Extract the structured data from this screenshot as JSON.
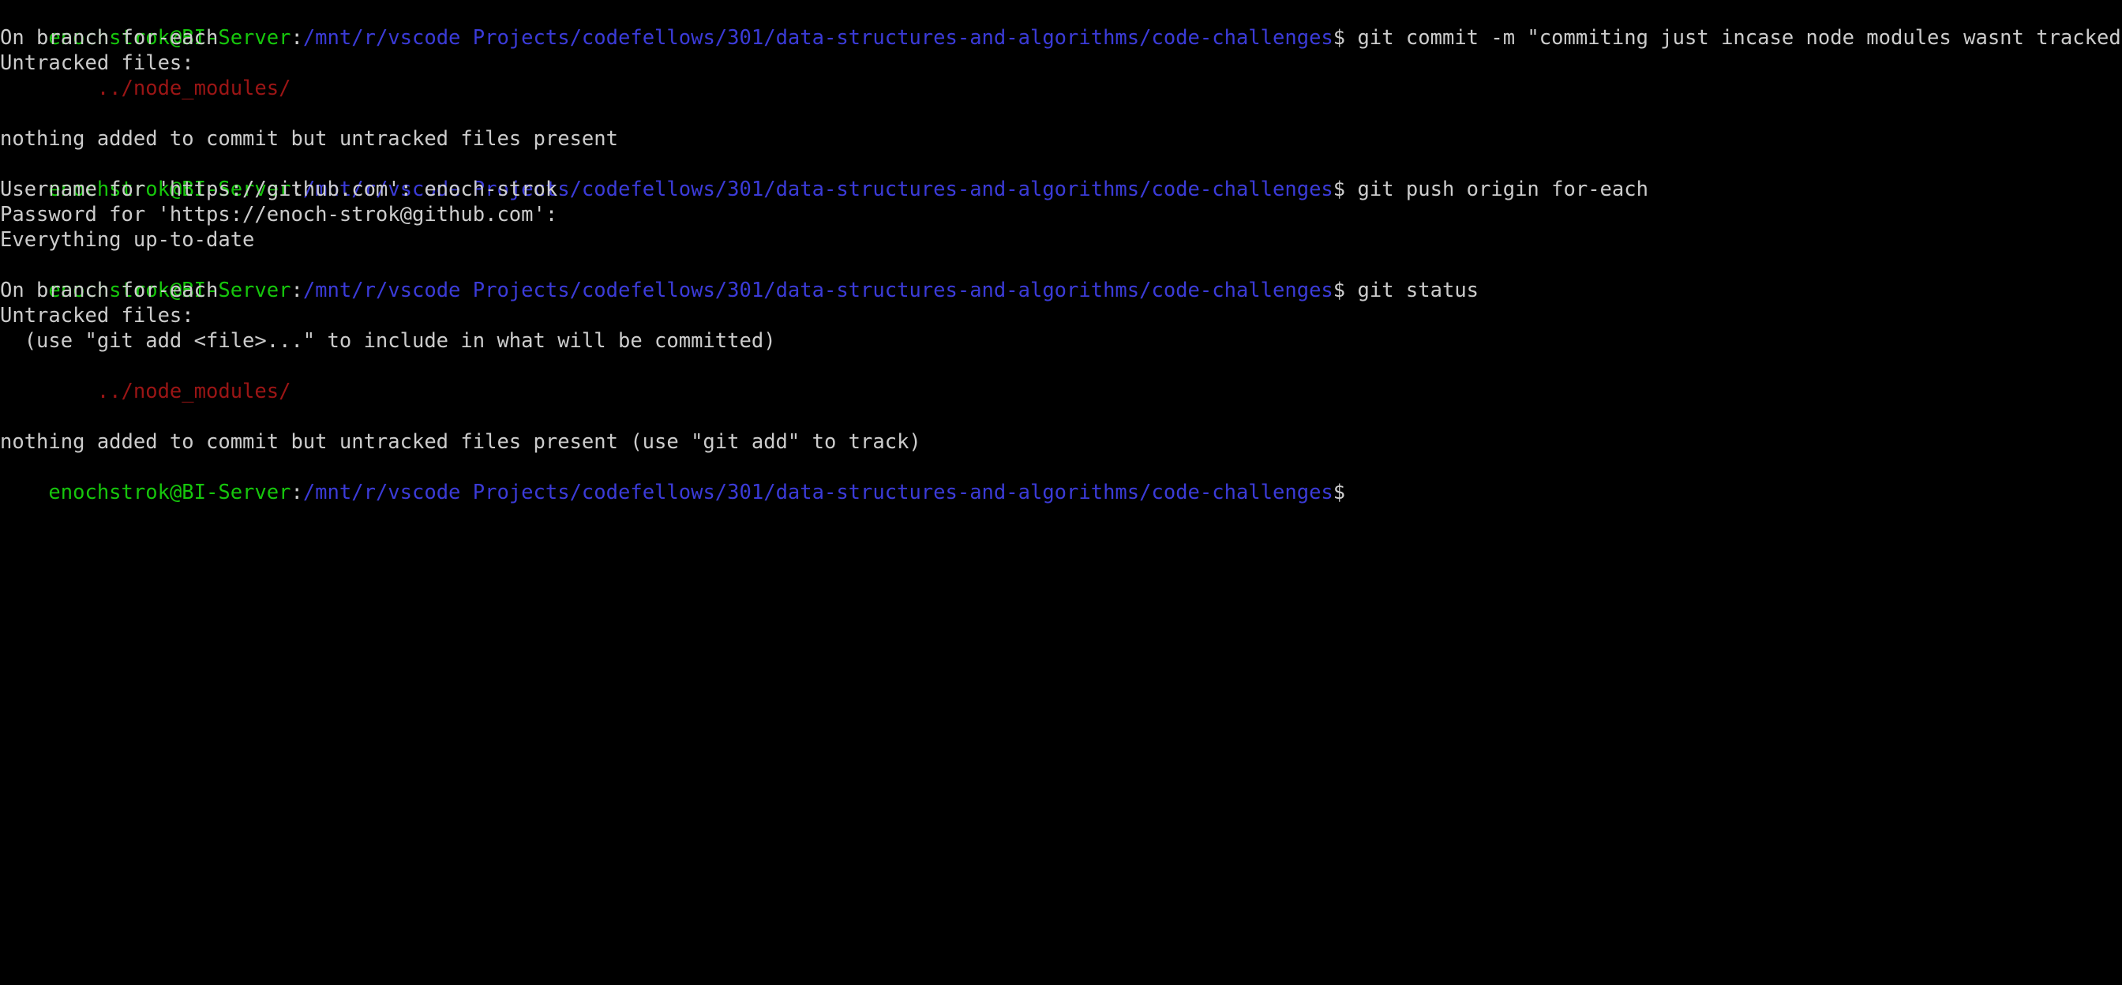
{
  "terminal": {
    "colors": {
      "background": "#000000",
      "text": "#cccccc",
      "user_host": "#16c60c",
      "path": "#3b3bd8",
      "untracked": "#9b1515"
    },
    "prompt": {
      "user_host": "enochstrok@BI-Server",
      "colon": ":",
      "path": "/mnt/r/vscode Projects/codefellows/301/data-structures-and-algorithms/code-challenges",
      "symbol": "$ "
    },
    "commands": {
      "commit": "git commit -m \"commiting just incase node modules wasnt tracked\"",
      "push": "git push origin for-each",
      "status": "git status"
    },
    "output": {
      "on_branch_1": "On branch for-each",
      "untracked_files_1": "Untracked files:",
      "node_modules_1": "        ../node_modules/",
      "nothing_added_1": "nothing added to commit but untracked files present",
      "username": "Username for 'https://github.com': enoch-strok",
      "password": "Password for 'https://enoch-strok@github.com':",
      "up_to_date": "Everything up-to-date",
      "on_branch_2": "On branch for-each",
      "untracked_files_2": "Untracked files:",
      "use_git_add": "  (use \"git add <file>...\" to include in what will be committed)",
      "node_modules_2": "        ../node_modules/",
      "nothing_added_2": "nothing added to commit but untracked files present (use \"git add\" to track)"
    }
  }
}
